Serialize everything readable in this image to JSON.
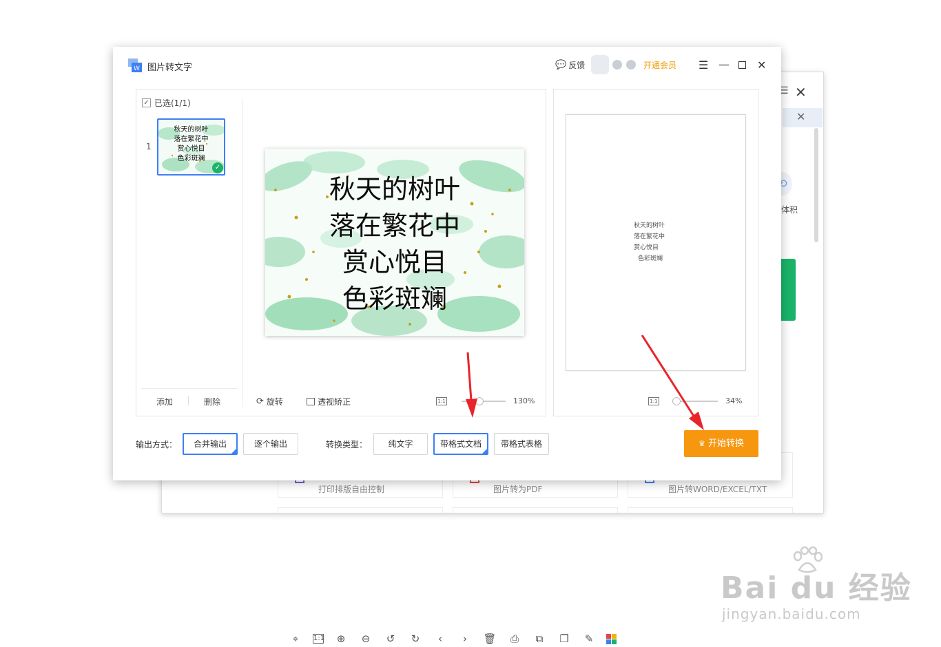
{
  "app": {
    "title": "图片转文字",
    "feedback": "反馈",
    "vip": "开通会员"
  },
  "left_panel": {
    "select_all": "已选(1/1)",
    "thumb_index": "1",
    "add": "添加",
    "delete": "删除",
    "rotate": "旋转",
    "perspective": "透视矫正",
    "fit": "1:1",
    "zoom": "130%"
  },
  "poem": [
    "秋天的树叶",
    "落在繁花中",
    "赏心悦目",
    "色彩斑斓"
  ],
  "right_panel": {
    "fit": "1:1",
    "zoom": "34%"
  },
  "options": {
    "output_label": "输出方式：",
    "merge_output": "合并输出",
    "single_output": "逐个输出",
    "convert_label": "转换类型：",
    "plain_text": "纯文字",
    "formatted_doc": "带格式文档",
    "formatted_table": "带格式表格",
    "start": "开始转换"
  },
  "background_window": {
    "volume_text": "体积",
    "cards": [
      "打印排版自由控制",
      "图片转为PDF",
      "图片转WORD/EXCEL/TXT"
    ]
  },
  "watermark": {
    "logo": "Bai du 经验",
    "sub": "jingyan.baidu.com"
  },
  "toolbar_icons": [
    "pin-icon",
    "actual-size-icon",
    "zoom-in-icon",
    "zoom-out-icon",
    "rotate-left-icon",
    "rotate-right-icon",
    "previous-icon",
    "next-icon",
    "delete-icon",
    "print-icon",
    "convert-icon",
    "copy-icon",
    "edit-icon",
    "apps-icon"
  ],
  "colors": {
    "accent": "#3d7ff5",
    "start_button": "#f7960f",
    "vip": "#f09c00",
    "success": "#1ab369",
    "arrow": "#e8242a"
  }
}
